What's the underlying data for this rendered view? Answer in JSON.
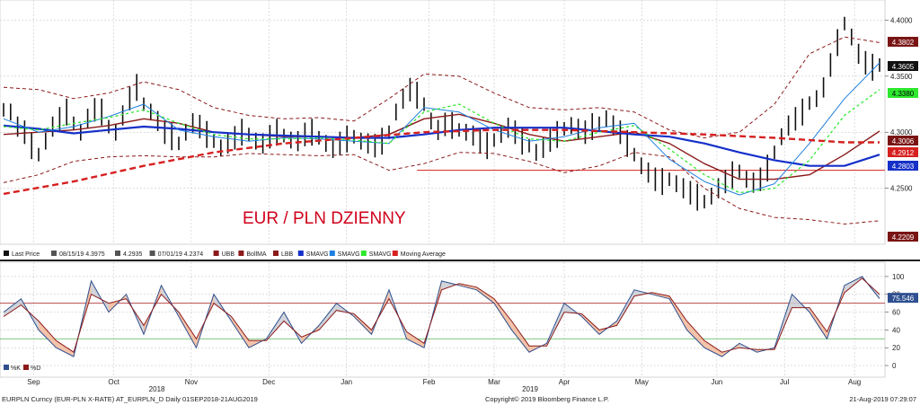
{
  "chart_data": [
    {
      "type": "line",
      "title": "EUR / PLN DZIENNY",
      "y_range": [
        4.2,
        4.41
      ],
      "y_ticks": [
        "4.4000",
        "4.3500",
        "4.3000",
        "4.2500"
      ],
      "x_ticks": [
        "Sep",
        "Oct",
        "Nov",
        "Dec",
        "Jan",
        "Feb",
        "Mar",
        "Apr",
        "May",
        "Jun",
        "Jul",
        "Aug"
      ],
      "x_year_labels": [
        "2018",
        "2019"
      ],
      "grid": true,
      "support_level": 4.266,
      "price_labels": [
        {
          "value": "4.3802",
          "bg": "#7a1414",
          "fg": "#ffffff"
        },
        {
          "value": "4.3605",
          "bg": "#111111",
          "fg": "#ffffff"
        },
        {
          "value": "4.3380",
          "bg": "#2ee82e",
          "fg": "#000000"
        },
        {
          "value": "4.3006",
          "bg": "#7a1414",
          "fg": "#ffffff"
        },
        {
          "value": "4.2912",
          "bg": "#d62020",
          "fg": "#ffffff"
        },
        {
          "value": "4.2803",
          "bg": "#1530c8",
          "fg": "#ffffff"
        },
        {
          "value": "4.2209",
          "bg": "#7a1414",
          "fg": "#ffffff"
        }
      ],
      "legend": [
        {
          "label": "Last Price",
          "color": "#111111"
        },
        {
          "label": "08/15/19 4.3975",
          "color": "#555555"
        },
        {
          "label": "4.2935",
          "color": "#555555"
        },
        {
          "label": "07/01/19 4.2374",
          "color": "#555555"
        },
        {
          "label": "UBB",
          "color": "#8b1a1a"
        },
        {
          "label": "BollMA",
          "color": "#8b1a1a"
        },
        {
          "label": "LBB",
          "color": "#8b1a1a"
        },
        {
          "label": "SMAVG",
          "color": "#1530c8"
        },
        {
          "label": "SMAVG",
          "color": "#1e7fe0"
        },
        {
          "label": "SMAVG",
          "color": "#2ee82e"
        },
        {
          "label": "Moving Average",
          "color": "#d62020"
        }
      ],
      "series": [
        {
          "name": "Last Price",
          "color": "#111111",
          "x": [
            0,
            2,
            4,
            6,
            8,
            10,
            12,
            14,
            16,
            18,
            20,
            22,
            24,
            26,
            28,
            30,
            32,
            34,
            36,
            38,
            40,
            42,
            44,
            46,
            48,
            50,
            52,
            54,
            56,
            58,
            60,
            62,
            64,
            66,
            68,
            70,
            72,
            74,
            76,
            78,
            80,
            82,
            84,
            86,
            88,
            90,
            92,
            94,
            96,
            98,
            100,
            102,
            104,
            106,
            108,
            110,
            112,
            114,
            116,
            118,
            120,
            122,
            124,
            126,
            128,
            130,
            132,
            134,
            136,
            138,
            140,
            142,
            144,
            146,
            148,
            150,
            152,
            154,
            156,
            158,
            160,
            162,
            164,
            166,
            168,
            170,
            172,
            174,
            176,
            178,
            180,
            182,
            184,
            186,
            188,
            190,
            192,
            194,
            196,
            198,
            200,
            202,
            204,
            206,
            208,
            210,
            212,
            214,
            216,
            218,
            220,
            222,
            224,
            226,
            228,
            230,
            232,
            234,
            236,
            238,
            240,
            242,
            244,
            246,
            248,
            250
          ],
          "values": [
            4.32,
            4.318,
            4.305,
            4.3,
            4.288,
            4.28,
            4.292,
            4.305,
            4.312,
            4.318,
            4.308,
            4.3,
            4.312,
            4.32,
            4.318,
            4.305,
            4.3,
            4.315,
            4.33,
            4.34,
            4.325,
            4.318,
            4.31,
            4.3,
            4.296,
            4.29,
            4.3,
            4.308,
            4.305,
            4.298,
            4.292,
            4.286,
            4.29,
            4.295,
            4.3,
            4.298,
            4.292,
            4.29,
            4.296,
            4.3,
            4.297,
            4.293,
            4.292,
            4.298,
            4.3,
            4.295,
            4.29,
            4.286,
            4.29,
            4.294,
            4.296,
            4.292,
            4.29,
            4.288,
            4.292,
            4.3,
            4.318,
            4.33,
            4.338,
            4.333,
            4.325,
            4.31,
            4.302,
            4.307,
            4.306,
            4.302,
            4.3,
            4.297,
            4.292,
            4.288,
            4.293,
            4.298,
            4.304,
            4.3,
            4.292,
            4.288,
            4.282,
            4.286,
            4.293,
            4.298,
            4.303,
            4.306,
            4.303,
            4.3,
            4.305,
            4.308,
            4.312,
            4.306,
            4.3,
            4.29,
            4.28,
            4.27,
            4.264,
            4.258,
            4.256,
            4.258,
            4.254,
            4.25,
            4.246,
            4.242,
            4.238,
            4.243,
            4.25,
            4.256,
            4.262,
            4.265,
            4.258,
            4.255,
            4.258,
            4.268,
            4.282,
            4.296,
            4.306,
            4.312,
            4.318,
            4.326,
            4.33,
            4.34,
            4.36,
            4.38,
            4.397,
            4.385,
            4.37,
            4.362,
            4.358,
            4.36
          ]
        },
        {
          "name": "UBB",
          "color": "#8b1a1a",
          "dash": "4,3",
          "x": [
            0,
            10,
            20,
            30,
            40,
            50,
            60,
            70,
            80,
            90,
            100,
            110,
            120,
            130,
            140,
            150,
            160,
            170,
            180,
            190,
            200,
            210,
            220,
            230,
            240,
            250
          ],
          "values": [
            4.34,
            4.338,
            4.33,
            4.335,
            4.345,
            4.338,
            4.322,
            4.315,
            4.312,
            4.313,
            4.31,
            4.33,
            4.352,
            4.35,
            4.335,
            4.322,
            4.32,
            4.322,
            4.318,
            4.302,
            4.295,
            4.3,
            4.325,
            4.37,
            4.385,
            4.38
          ]
        },
        {
          "name": "BollMA",
          "color": "#8b1a1a",
          "width": 1.4,
          "x": [
            0,
            10,
            20,
            30,
            40,
            50,
            60,
            70,
            80,
            90,
            100,
            110,
            120,
            130,
            140,
            150,
            160,
            170,
            180,
            190,
            200,
            210,
            220,
            230,
            240,
            250
          ],
          "values": [
            4.298,
            4.3,
            4.302,
            4.306,
            4.312,
            4.308,
            4.3,
            4.298,
            4.296,
            4.296,
            4.295,
            4.298,
            4.312,
            4.316,
            4.308,
            4.298,
            4.292,
            4.296,
            4.3,
            4.29,
            4.272,
            4.258,
            4.258,
            4.262,
            4.28,
            4.301
          ]
        },
        {
          "name": "LBB",
          "color": "#8b1a1a",
          "dash": "4,3",
          "x": [
            0,
            10,
            20,
            30,
            40,
            50,
            60,
            70,
            80,
            90,
            100,
            110,
            120,
            130,
            140,
            150,
            160,
            170,
            180,
            190,
            200,
            210,
            220,
            230,
            240,
            250
          ],
          "values": [
            4.255,
            4.262,
            4.274,
            4.278,
            4.279,
            4.278,
            4.278,
            4.281,
            4.28,
            4.279,
            4.28,
            4.266,
            4.272,
            4.282,
            4.281,
            4.274,
            4.264,
            4.27,
            4.282,
            4.278,
            4.25,
            4.232,
            4.224,
            4.222,
            4.218,
            4.221
          ]
        },
        {
          "name": "SMAVG",
          "color": "#1530c8",
          "width": 2.2,
          "x": [
            0,
            10,
            20,
            30,
            40,
            50,
            60,
            70,
            80,
            90,
            100,
            110,
            120,
            130,
            140,
            150,
            160,
            170,
            180,
            190,
            200,
            210,
            220,
            230,
            240,
            250
          ],
          "values": [
            4.306,
            4.303,
            4.299,
            4.302,
            4.305,
            4.303,
            4.3,
            4.298,
            4.297,
            4.296,
            4.295,
            4.295,
            4.298,
            4.302,
            4.304,
            4.304,
            4.304,
            4.301,
            4.298,
            4.296,
            4.29,
            4.282,
            4.275,
            4.27,
            4.27,
            4.28
          ]
        },
        {
          "name": "SMAVG",
          "color": "#1e7fe0",
          "width": 1,
          "x": [
            0,
            10,
            20,
            30,
            40,
            50,
            60,
            70,
            80,
            90,
            100,
            110,
            120,
            130,
            140,
            150,
            160,
            170,
            180,
            190,
            200,
            210,
            220,
            230,
            240,
            250
          ],
          "values": [
            4.312,
            4.3,
            4.305,
            4.314,
            4.325,
            4.302,
            4.296,
            4.292,
            4.295,
            4.294,
            4.292,
            4.29,
            4.322,
            4.318,
            4.302,
            4.292,
            4.296,
            4.304,
            4.308,
            4.276,
            4.256,
            4.244,
            4.254,
            4.29,
            4.33,
            4.362
          ]
        },
        {
          "name": "SMAVG",
          "color": "#2ee82e",
          "dash": "3,3",
          "width": 1.3,
          "x": [
            0,
            10,
            20,
            30,
            40,
            50,
            60,
            70,
            80,
            90,
            100,
            110,
            120,
            130,
            140,
            150,
            160,
            170,
            180,
            190,
            200,
            210,
            220,
            230,
            240,
            250
          ],
          "values": [
            4.305,
            4.302,
            4.308,
            4.313,
            4.32,
            4.308,
            4.298,
            4.294,
            4.294,
            4.295,
            4.293,
            4.29,
            4.318,
            4.325,
            4.308,
            4.294,
            4.292,
            4.3,
            4.306,
            4.285,
            4.262,
            4.246,
            4.25,
            4.275,
            4.315,
            4.338
          ]
        },
        {
          "name": "Moving Average",
          "color": "#d62020",
          "dash": "7,4",
          "width": 2.4,
          "x": [
            0,
            20,
            40,
            60,
            80,
            100,
            120,
            140,
            160,
            180,
            200,
            220,
            240,
            250
          ],
          "values": [
            4.245,
            4.256,
            4.27,
            4.282,
            4.29,
            4.295,
            4.3,
            4.302,
            4.302,
            4.3,
            4.298,
            4.295,
            4.291,
            4.291
          ]
        }
      ]
    },
    {
      "type": "line",
      "y_range": [
        -5,
        110
      ],
      "y_ticks": [
        "100",
        "80",
        "60",
        "40",
        "20",
        "0"
      ],
      "current_value": "75.546",
      "overbought": 70,
      "oversold": 30,
      "legend": [
        {
          "label": "%K",
          "color": "#2f4f8f"
        },
        {
          "label": "%D",
          "color": "#8b1a1a"
        }
      ],
      "series": [
        {
          "name": "%K",
          "color": "#2f4f8f",
          "x": [
            0,
            5,
            10,
            15,
            20,
            25,
            30,
            35,
            40,
            45,
            50,
            55,
            60,
            65,
            70,
            75,
            80,
            85,
            90,
            95,
            100,
            105,
            110,
            115,
            120,
            125,
            130,
            135,
            140,
            145,
            150,
            155,
            160,
            165,
            170,
            175,
            180,
            185,
            190,
            195,
            200,
            205,
            210,
            215,
            220,
            225,
            230,
            235,
            240,
            245,
            250
          ],
          "values": [
            60,
            75,
            40,
            20,
            10,
            95,
            60,
            80,
            35,
            90,
            55,
            20,
            80,
            50,
            20,
            30,
            60,
            25,
            45,
            70,
            55,
            35,
            85,
            30,
            20,
            95,
            90,
            85,
            70,
            40,
            15,
            25,
            70,
            55,
            35,
            50,
            85,
            80,
            75,
            40,
            20,
            10,
            25,
            15,
            20,
            80,
            60,
            30,
            90,
            100,
            75
          ]
        },
        {
          "name": "%D",
          "color": "#8b1a1a",
          "x": [
            0,
            5,
            10,
            15,
            20,
            25,
            30,
            35,
            40,
            45,
            50,
            55,
            60,
            65,
            70,
            75,
            80,
            85,
            90,
            95,
            100,
            105,
            110,
            115,
            120,
            125,
            130,
            135,
            140,
            145,
            150,
            155,
            160,
            165,
            170,
            175,
            180,
            185,
            190,
            195,
            200,
            205,
            210,
            215,
            220,
            225,
            230,
            235,
            240,
            245,
            250
          ],
          "values": [
            55,
            68,
            50,
            28,
            15,
            80,
            70,
            75,
            45,
            80,
            60,
            30,
            70,
            55,
            28,
            28,
            50,
            32,
            40,
            62,
            58,
            40,
            75,
            38,
            25,
            85,
            92,
            88,
            75,
            50,
            22,
            22,
            60,
            58,
            40,
            45,
            78,
            82,
            78,
            50,
            28,
            15,
            20,
            18,
            18,
            65,
            65,
            38,
            82,
            98,
            80
          ]
        }
      ]
    }
  ],
  "footer": {
    "left": "EURPLN Curncy (EUR-PLN X-RATE) AT_EURPLN_D  Daily 01SEP2018-21AUG2019",
    "center": "Copyright© 2019 Bloomberg Finance L.P.",
    "right": "21-Aug-2019 07:29:07"
  }
}
